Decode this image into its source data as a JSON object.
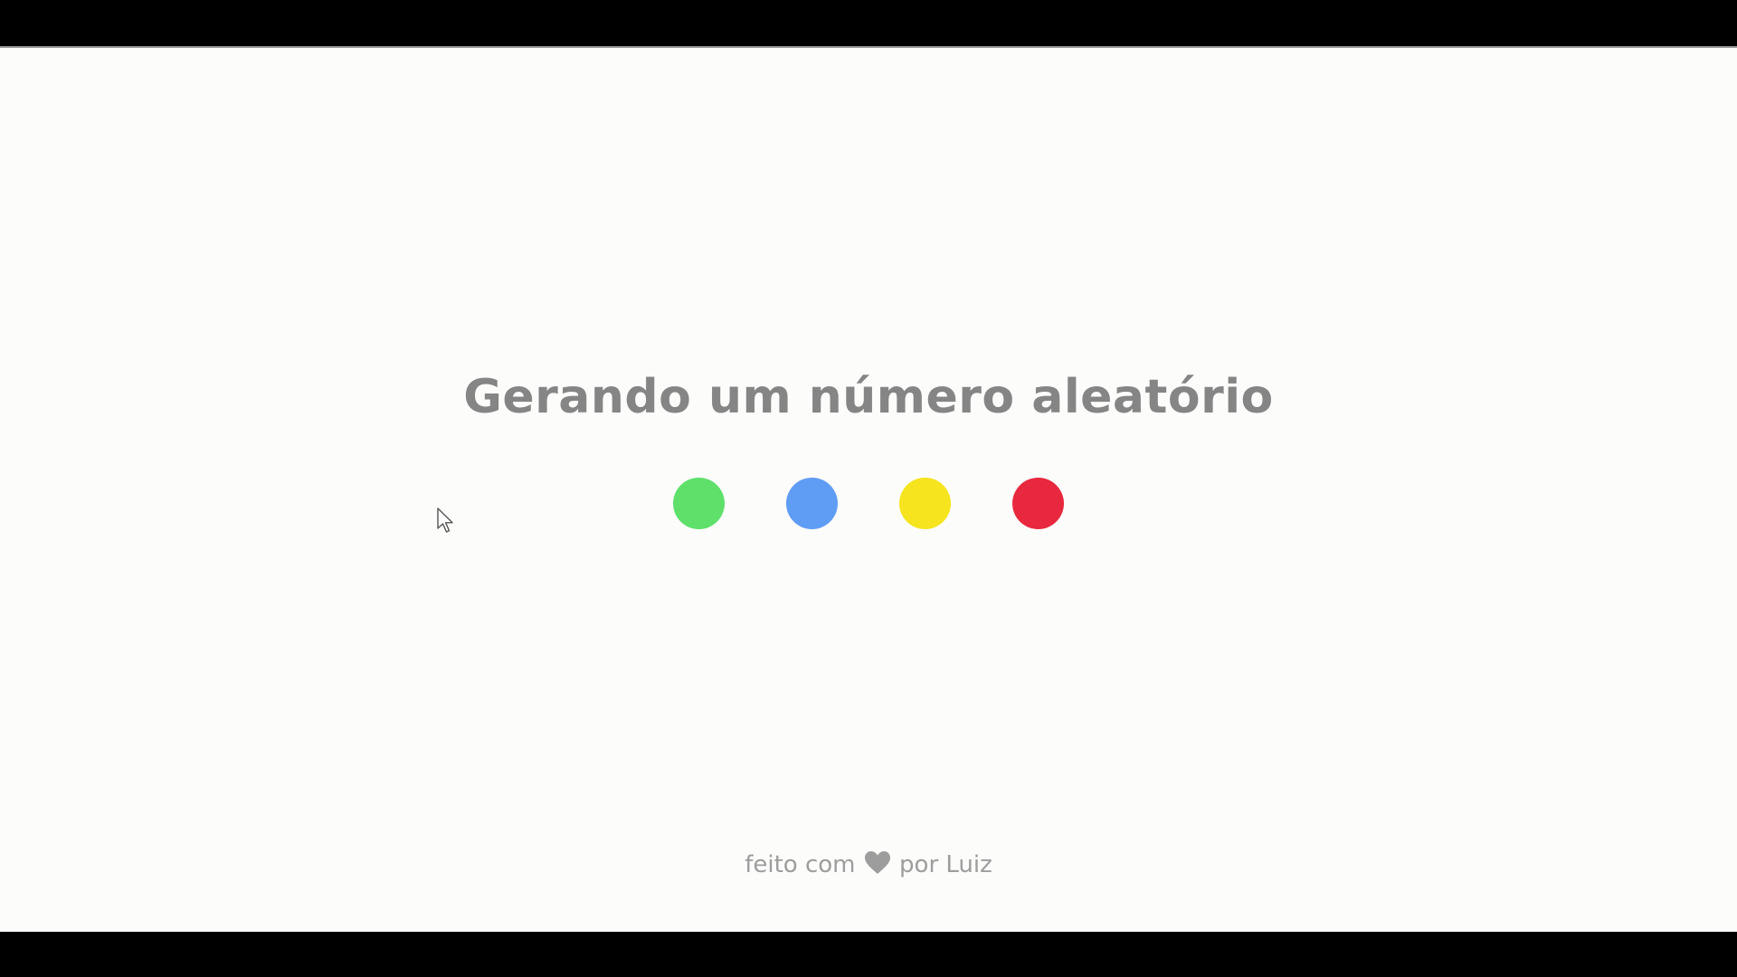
{
  "title": "Gerando um número aleatório",
  "dots": [
    {
      "color": "#5ee06a"
    },
    {
      "color": "#5f9cf4"
    },
    {
      "color": "#f6e41e"
    },
    {
      "color": "#e8283e"
    }
  ],
  "footer": {
    "prefix": "feito com",
    "icon": "heart-icon",
    "suffix": "por Luiz"
  }
}
